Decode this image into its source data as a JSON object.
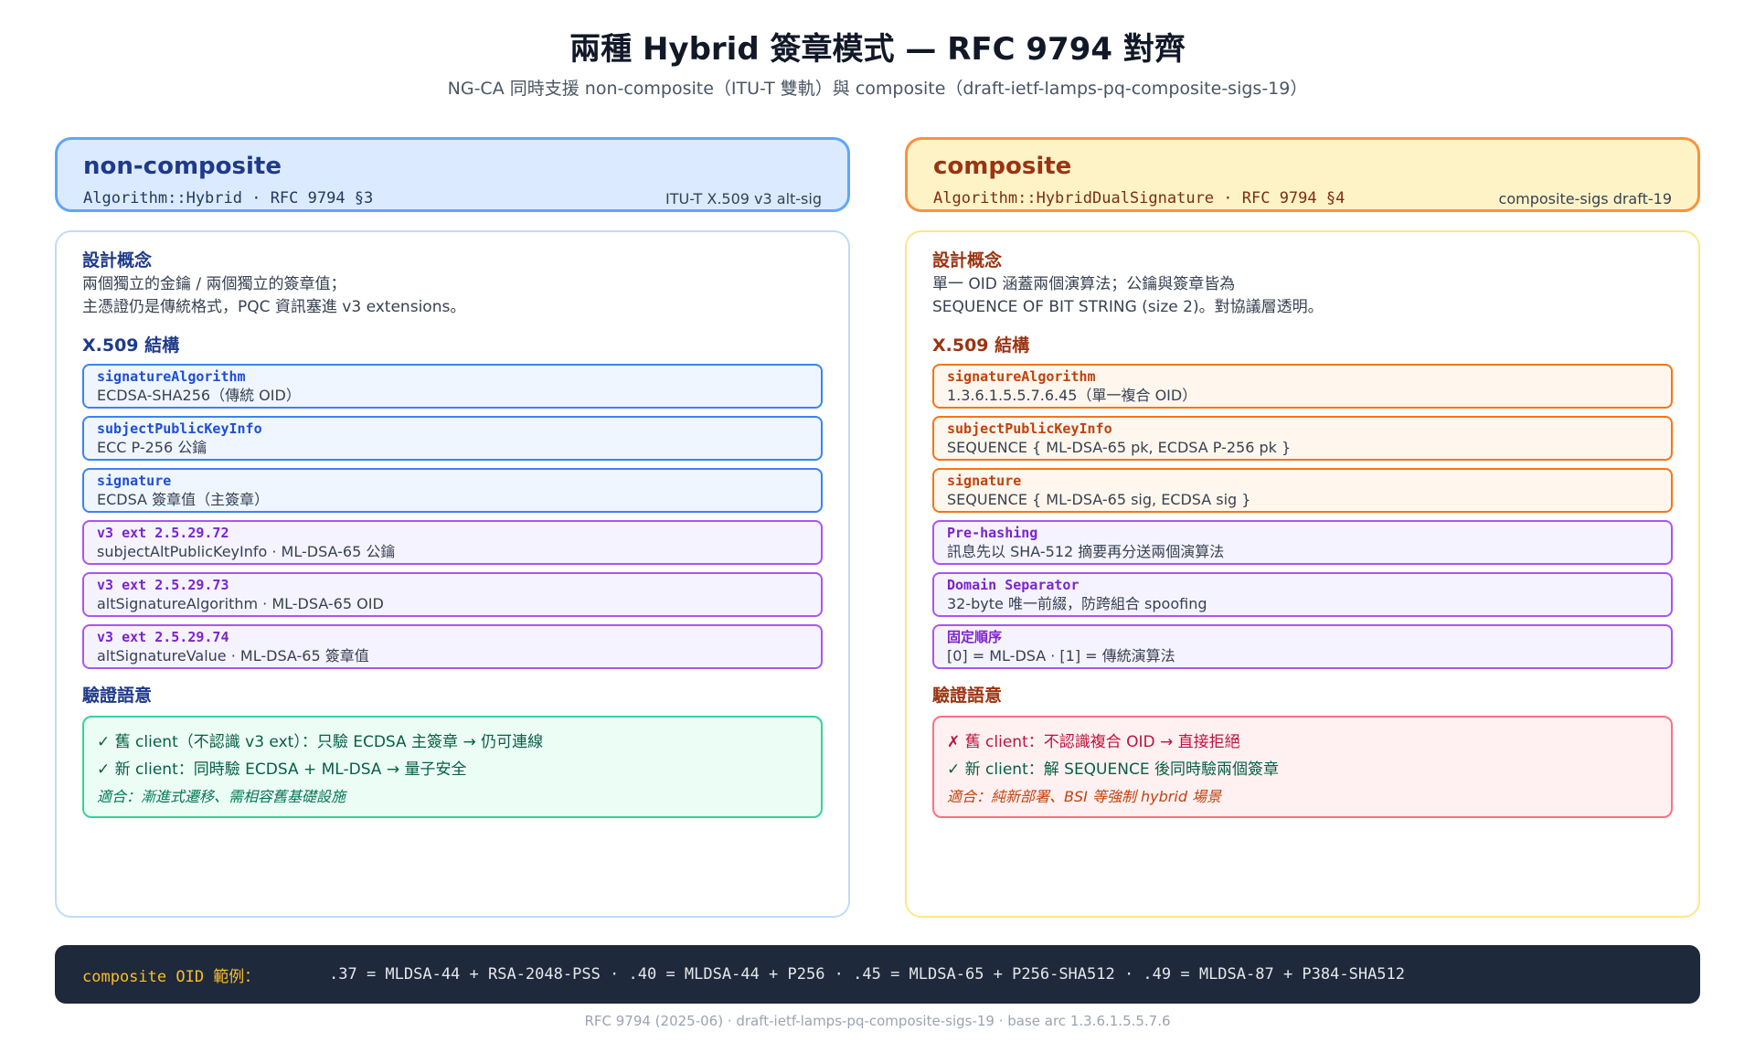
{
  "title": "兩種 Hybrid 簽章模式 — RFC 9794 對齊",
  "subtitle": "NG-CA 同時支援 non-composite（ITU-T 雙軌）與 composite（draft-ietf-lamps-pq-composite-sigs-19）",
  "left": {
    "title": "non-composite",
    "algo": "Algorithm::Hybrid · RFC 9794 §3",
    "note": "ITU-T X.509 v3 alt-sig",
    "concept_title": "設計概念",
    "concept_line1": "兩個獨立的金鑰 / 兩個獨立的簽章值；",
    "concept_line2": "主憑證仍是傳統格式，PQC 資訊塞進 v3 extensions。",
    "struct_title": "X.509 結構",
    "fields": [
      {
        "name": "signatureAlgorithm",
        "desc": "ECDSA-SHA256（傳統 OID）"
      },
      {
        "name": "subjectPublicKeyInfo",
        "desc": "ECC P-256 公鑰"
      },
      {
        "name": "signature",
        "desc": "ECDSA 簽章值（主簽章）"
      },
      {
        "name": "v3 ext 2.5.29.72",
        "desc": "subjectAltPublicKeyInfo · ML-DSA-65 公鑰"
      },
      {
        "name": "v3 ext 2.5.29.73",
        "desc": "altSignatureAlgorithm · ML-DSA-65 OID"
      },
      {
        "name": "v3 ext 2.5.29.74",
        "desc": "altSignatureValue · ML-DSA-65 簽章值"
      }
    ],
    "verify_title": "驗證語意",
    "verify_line1": "✓ 舊 client（不認識 v3 ext）：只驗 ECDSA 主簽章 → 仍可連線",
    "verify_line2": "✓ 新 client：同時驗 ECDSA + ML-DSA → 量子安全",
    "verify_note": "適合：漸進式遷移、需相容舊基礎設施"
  },
  "right": {
    "title": "composite",
    "algo": "Algorithm::HybridDualSignature · RFC 9794 §4",
    "note": "composite-sigs draft-19",
    "concept_title": "設計概念",
    "concept_line1": "單一 OID 涵蓋兩個演算法；公鑰與簽章皆為",
    "concept_line2": "SEQUENCE OF BIT STRING (size 2)。對協議層透明。",
    "struct_title": "X.509 結構",
    "fields": [
      {
        "name": "signatureAlgorithm",
        "desc": "1.3.6.1.5.5.7.6.45（單一複合 OID）"
      },
      {
        "name": "subjectPublicKeyInfo",
        "desc": "SEQUENCE { ML-DSA-65 pk, ECDSA P-256 pk }"
      },
      {
        "name": "signature",
        "desc": "SEQUENCE { ML-DSA-65 sig, ECDSA sig }"
      },
      {
        "name": "Pre-hashing",
        "desc": "訊息先以 SHA-512 摘要再分送兩個演算法"
      },
      {
        "name": "Domain Separator",
        "desc": "32-byte 唯一前綴，防跨組合 spoofing"
      },
      {
        "name": "固定順序",
        "desc": "[0] = ML-DSA · [1] = 傳統演算法"
      }
    ],
    "verify_title": "驗證語意",
    "verify_line1": "✗ 舊 client：不認識複合 OID → 直接拒絕",
    "verify_line2": "✓ 新 client：解 SEQUENCE 後同時驗兩個簽章",
    "verify_note": "適合：純新部署、BSI 等強制 hybrid 場景"
  },
  "oid_bar": {
    "label": "composite OID 範例：",
    "list": ".37 = MLDSA-44 + RSA-2048-PSS · .40 = MLDSA-44 + P256 · .45 = MLDSA-65 + P256-SHA512 · .49 = MLDSA-87 + P384-SHA512"
  },
  "footer": "RFC 9794 (2025-06) · draft-ietf-lamps-pq-composite-sigs-19 · base arc 1.3.6.1.5.5.7.6"
}
